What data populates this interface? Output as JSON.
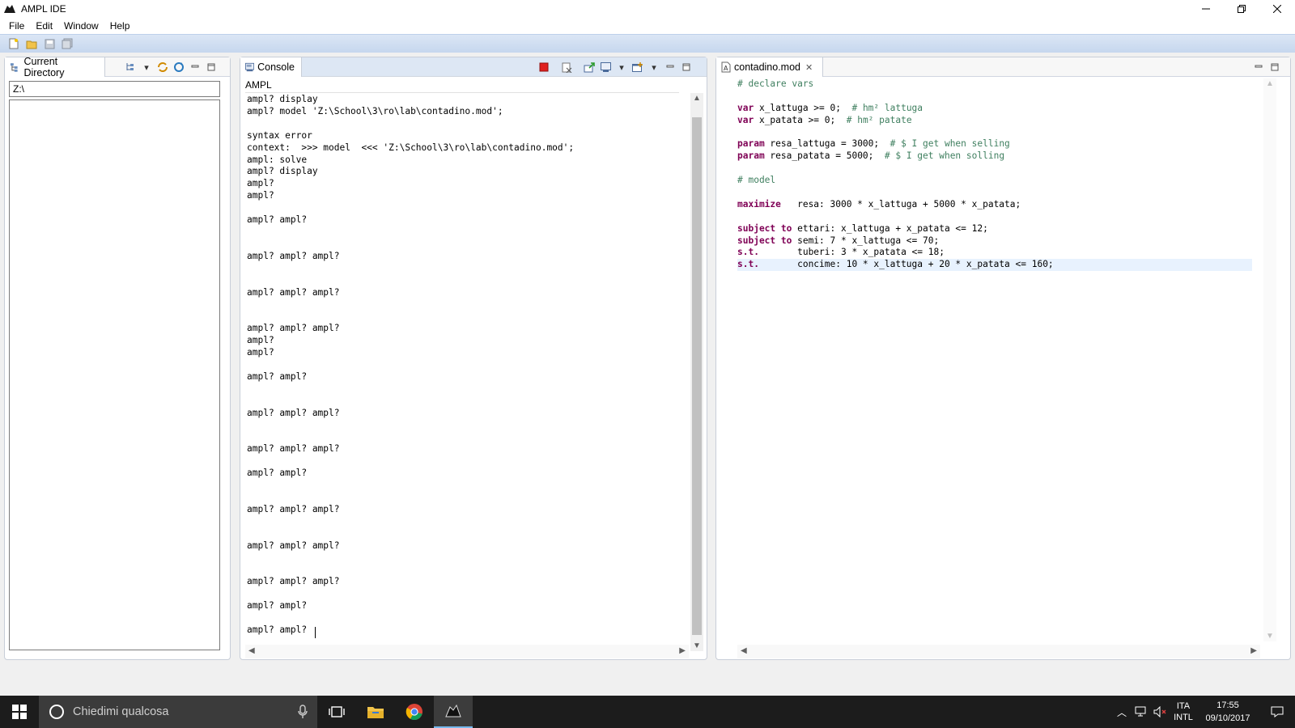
{
  "window": {
    "title": "AMPL IDE",
    "controls": [
      "minimize",
      "restore",
      "close"
    ]
  },
  "menu": {
    "items": [
      "File",
      "Edit",
      "Window",
      "Help"
    ]
  },
  "toolbar": {
    "icons": [
      "new-file-icon",
      "open-folder-icon",
      "save-icon",
      "save-all-icon"
    ]
  },
  "directory_panel": {
    "tab_label": "Current Directory",
    "path": "Z:\\"
  },
  "console_panel": {
    "tab_label": "Console",
    "header": "AMPL",
    "text": "ampl? display\nampl? model 'Z:\\School\\3\\ro\\lab\\contadino.mod';\n\nsyntax error\ncontext:  >>> model  <<< 'Z:\\School\\3\\ro\\lab\\contadino.mod';\nampl: solve\nampl? display\nampl?\nampl?\n\nampl? ampl?\n\n\nampl? ampl? ampl?\n\n\nampl? ampl? ampl?\n\n\nampl? ampl? ampl?\nampl?\nampl?\n\nampl? ampl?\n\n\nampl? ampl? ampl?\n\n\nampl? ampl? ampl?\n\nampl? ampl?\n\n\nampl? ampl? ampl?\n\n\nampl? ampl? ampl?\n\n\nampl? ampl? ampl?\n\nampl? ampl?\n\nampl? ampl? "
  },
  "editor_panel": {
    "tab_label": "contadino.mod",
    "lines": [
      [
        {
          "t": "# declare vars",
          "c": "cm"
        }
      ],
      [],
      [
        {
          "t": "var",
          "c": "kw"
        },
        {
          "t": " x_lattuga >= 0;  "
        },
        {
          "t": "# hm² lattuga",
          "c": "cm"
        }
      ],
      [
        {
          "t": "var",
          "c": "kw"
        },
        {
          "t": " x_patata >= 0;  "
        },
        {
          "t": "# hm² patate",
          "c": "cm"
        }
      ],
      [],
      [
        {
          "t": "param",
          "c": "kw"
        },
        {
          "t": " resa_lattuga = 3000;  "
        },
        {
          "t": "# $ I get when selling",
          "c": "cm"
        }
      ],
      [
        {
          "t": "param",
          "c": "kw"
        },
        {
          "t": " resa_patata = 5000;  "
        },
        {
          "t": "# $ I get when solling",
          "c": "cm"
        }
      ],
      [],
      [
        {
          "t": "# model",
          "c": "cm"
        }
      ],
      [],
      [
        {
          "t": "maximize",
          "c": "kw"
        },
        {
          "t": "   resa: 3000 * x_lattuga + 5000 * x_patata;"
        }
      ],
      [],
      [
        {
          "t": "subject to",
          "c": "kw"
        },
        {
          "t": " ettari: x_lattuga + x_patata <= 12;"
        }
      ],
      [
        {
          "t": "subject to",
          "c": "kw"
        },
        {
          "t": " semi: 7 * x_lattuga <= 70;"
        }
      ],
      [
        {
          "t": "s.t.",
          "c": "kw"
        },
        {
          "t": "       tuberi: 3 * x_patata <= 18;"
        }
      ],
      [
        {
          "t": "s.t.",
          "c": "kw"
        },
        {
          "t": "       concime: 10 * x_lattuga + 20 * x_patata <= 160;"
        }
      ]
    ],
    "highlighted_line": 15
  },
  "taskbar": {
    "search_placeholder": "Chiedimi qualcosa",
    "apps": [
      "task-view-icon",
      "file-explorer-icon",
      "chrome-icon",
      "ampl-icon"
    ],
    "lang_top": "ITA",
    "lang_bottom": "INTL",
    "time": "17:55",
    "date": "09/10/2017"
  }
}
